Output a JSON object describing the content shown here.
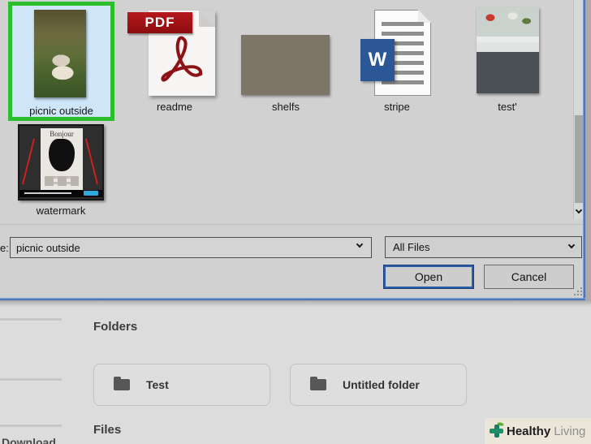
{
  "dialog": {
    "files": [
      {
        "name": "picnic outside",
        "type": "image",
        "selected": true
      },
      {
        "name": "readme",
        "type": "pdf"
      },
      {
        "name": "shelfs",
        "type": "image"
      },
      {
        "name": "stripe",
        "type": "word"
      },
      {
        "name": "test'",
        "type": "image"
      },
      {
        "name": "watermark",
        "type": "image"
      }
    ],
    "pdf_badge": "PDF",
    "word_letter": "W",
    "watermark_thumb_title": "Bonjour",
    "file_name_label_partial": "e:",
    "file_name_value": "picnic outside",
    "file_type_value": "All Files",
    "open_label": "Open",
    "cancel_label": "Cancel"
  },
  "drive": {
    "folders_heading": "Folders",
    "files_heading": "Files",
    "folder_cards": [
      {
        "label": "Test"
      },
      {
        "label": "Untitled folder"
      }
    ],
    "sidebar_partial_text": "Download",
    "badge_bold": "Healthy",
    "badge_light": "Living"
  },
  "colors": {
    "annotation_green": "#2cbe2c",
    "selection_blue": "#cfe6f9",
    "window_border_blue": "#2e5fa8",
    "open_button_border": "#2a5ca8",
    "pdf_red": "#9c1014",
    "word_blue": "#2b5797",
    "badge_teal": "#177e66",
    "badge_leaf_green": "#5cb130"
  }
}
